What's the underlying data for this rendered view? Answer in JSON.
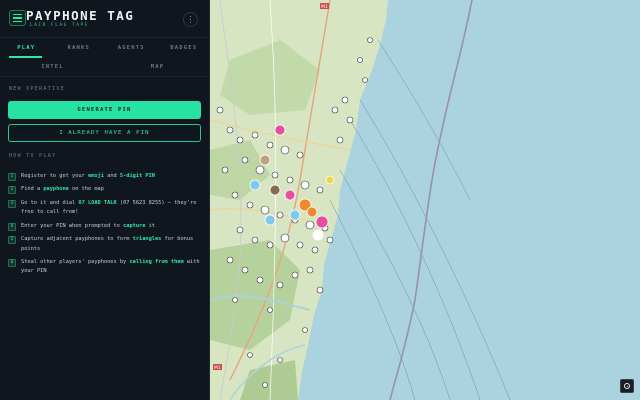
{
  "app": {
    "title": "PAYPHONE TAG",
    "subtitle": "LAIR FLAG TAPE"
  },
  "tabs_row1": [
    {
      "label": "PLAY",
      "active": true
    },
    {
      "label": "RANKS",
      "active": false
    },
    {
      "label": "AGENTS",
      "active": false
    },
    {
      "label": "BADGES",
      "active": false
    }
  ],
  "tabs_row2": [
    {
      "label": "INTEL"
    },
    {
      "label": "MAP"
    }
  ],
  "new_operative": {
    "label": "NEW OPERATIVE",
    "generate_label": "GENERATE PIN",
    "have_pin_label": "I ALREADY HAVE A PIN"
  },
  "how_to_play": {
    "label": "HOW TO PLAY",
    "steps": [
      {
        "num": "1",
        "parts": [
          {
            "t": "Register to get your "
          },
          {
            "t": "emoji",
            "hl": true
          },
          {
            "t": " and "
          },
          {
            "t": "5-digit PIN",
            "hl": true
          }
        ]
      },
      {
        "num": "2",
        "parts": [
          {
            "t": "Find a "
          },
          {
            "t": "payphone",
            "hl": true
          },
          {
            "t": " on the map"
          }
        ]
      },
      {
        "num": "3",
        "parts": [
          {
            "t": "Go to it and dial "
          },
          {
            "t": "07 LOAD TALK",
            "hl": true
          },
          {
            "t": " (07 5623 8255) — they're free to call from!"
          }
        ]
      },
      {
        "num": "4",
        "parts": [
          {
            "t": "Enter your PIN when prompted to "
          },
          {
            "t": "capture",
            "hl": true
          },
          {
            "t": " it"
          }
        ]
      },
      {
        "num": "5",
        "parts": [
          {
            "t": "Capture adjacent payphones to form "
          },
          {
            "t": "triangles",
            "hl": true
          },
          {
            "t": " for bonus points"
          }
        ]
      },
      {
        "num": "6",
        "parts": [
          {
            "t": "Steal other players' payphones by "
          },
          {
            "t": "calling from them",
            "hl": true
          },
          {
            "t": " with your PIN"
          }
        ]
      }
    ]
  },
  "map": {
    "road_labels": [
      "M1",
      "M1"
    ],
    "colors": {
      "ocean": "#aad3df",
      "land": "#d9e6c4",
      "forest": "#b9d39c",
      "accent": "#2ee6a6"
    }
  }
}
